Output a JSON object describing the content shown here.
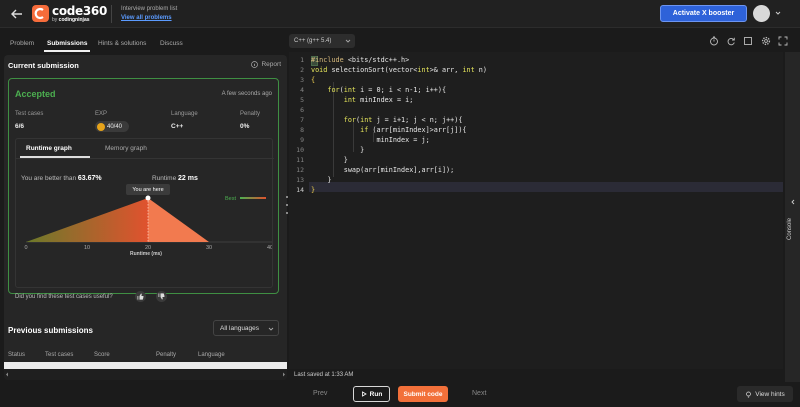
{
  "header": {
    "logo_text": "code360",
    "logo_by": "by",
    "logo_brand": "codingninjas",
    "crumb_label": "Interview problem list",
    "crumb_link": "View all problems",
    "booster_label": "Activate X booster"
  },
  "tabs": [
    {
      "label": "Problem"
    },
    {
      "label": "Submissions"
    },
    {
      "label": "Hints & solutions"
    },
    {
      "label": "Discuss"
    }
  ],
  "current_submission": {
    "title": "Current submission",
    "report_label": "Report",
    "status": "Accepted",
    "time_ago": "A few seconds ago",
    "stats": [
      {
        "label": "Test cases",
        "value": "6/6"
      },
      {
        "label": "EXP",
        "value": "40/40"
      },
      {
        "label": "Language",
        "value": "C++"
      },
      {
        "label": "Penalty",
        "value": "0%"
      }
    ],
    "graph_tabs": [
      "Runtime graph",
      "Memory graph"
    ],
    "better_than_label": "You are better than",
    "better_than_value": "63.67%",
    "runtime_label": "Runtime",
    "runtime_value": "22 ms",
    "feedback_question": "Did you find these test cases useful?"
  },
  "chart_data": {
    "type": "area",
    "x_ticks": [
      "0",
      "10",
      "20",
      "30",
      "40"
    ],
    "xlabel": "Runtime (ms)",
    "xlim": [
      0,
      40
    ],
    "peak_x": 20,
    "your_runtime": 22,
    "marker_label": "You are here",
    "legend_label": "Best",
    "colors": {
      "low": "#6b7a2a",
      "high": "#e0522e",
      "right": "#f27a4f"
    }
  },
  "previous_submissions": {
    "title": "Previous submissions",
    "filter_value": "All languages",
    "columns": [
      "Status",
      "Test cases",
      "Score",
      "Penalty",
      "Language"
    ]
  },
  "editor": {
    "language": "C++ (g++ 5.4)",
    "line_numbers": [
      "1",
      "2",
      "3",
      "4",
      "5",
      "6",
      "7",
      "8",
      "9",
      "10",
      "11",
      "12",
      "13",
      "14"
    ],
    "saved_text": "Last saved at 1:33 AM"
  },
  "console_label": "Console",
  "bottom": {
    "prev_label": "Prev",
    "run_label": "Run",
    "submit_label": "Submit code",
    "next_label": "Next",
    "hints_label": "View hints"
  }
}
